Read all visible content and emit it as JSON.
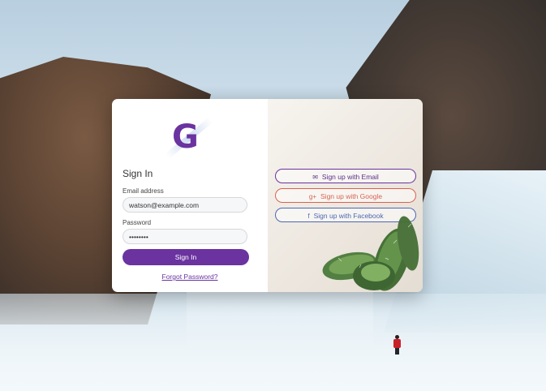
{
  "logo": {
    "letter": "G"
  },
  "signin": {
    "title": "Sign In",
    "email_label": "Email address",
    "email_value": "watson@example.com",
    "password_label": "Password",
    "password_value": "••••••••",
    "submit_label": "Sign In",
    "forgot_label": "Forgot Password?"
  },
  "signup": {
    "email_label": "Sign up with Email",
    "email_icon": "envelope-icon",
    "google_label": "Sign up with Google",
    "google_icon": "google-plus-icon",
    "facebook_label": "Sign up with Facebook",
    "facebook_icon": "facebook-icon"
  },
  "colors": {
    "accent": "#6a33a0",
    "google": "#d9634f",
    "facebook": "#4c67b4"
  }
}
